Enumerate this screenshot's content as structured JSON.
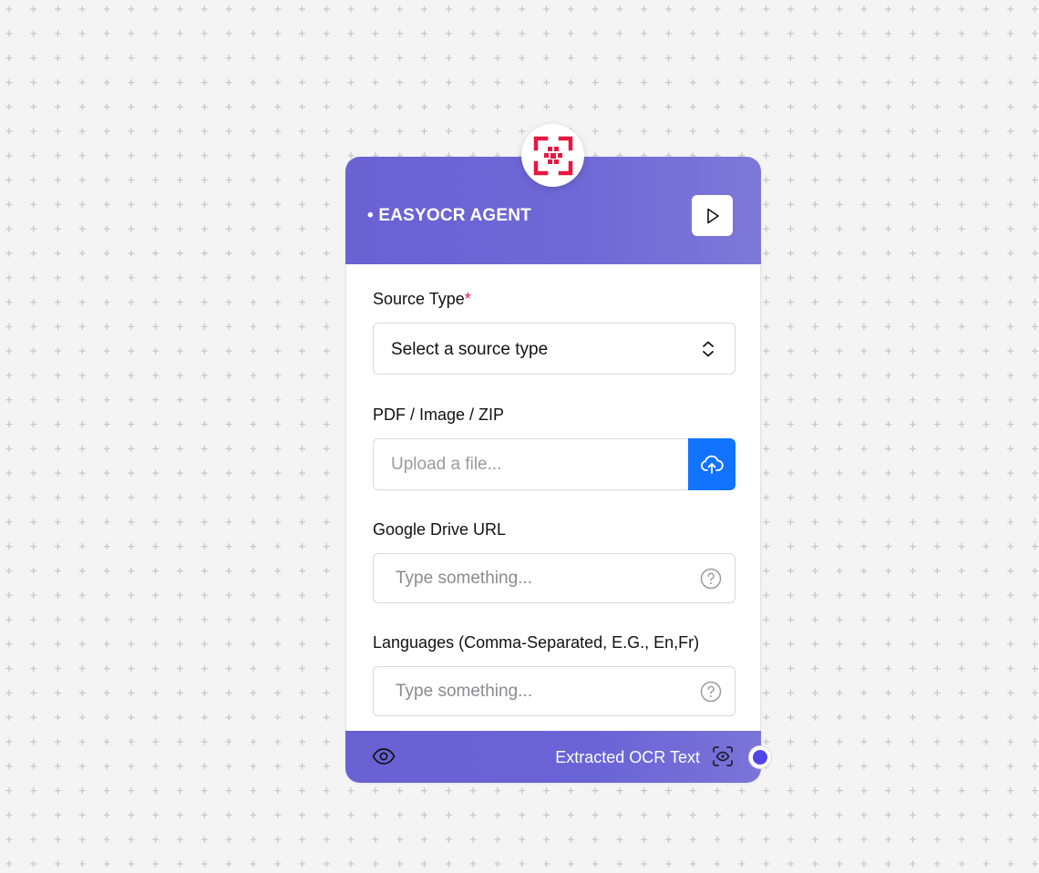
{
  "node": {
    "title": "• EASYOCR AGENT",
    "logo_icon": "ocr-scan-icon",
    "run_icon": "play-icon",
    "accent_color": "#6a61d3",
    "logo_color": "#e8173f"
  },
  "fields": {
    "source_type": {
      "label": "Source Type",
      "required_mark": "*",
      "selected_value": "Select a source type",
      "icon": "chevron-up-down-icon"
    },
    "file_upload": {
      "label": "PDF / Image / ZIP",
      "placeholder": "Upload a file...",
      "button_icon": "cloud-upload-icon",
      "button_color": "#1273ff"
    },
    "drive_url": {
      "label": "Google Drive URL",
      "placeholder": "Type something...",
      "help_icon": "question-circle-icon"
    },
    "languages": {
      "label": "Languages (Comma-Separated, E.G., En,Fr)",
      "placeholder": "Type something...",
      "help_icon": "question-circle-icon"
    }
  },
  "footer": {
    "preview_icon": "eye-icon",
    "output_label": "Extracted OCR Text",
    "output_icon": "scan-eye-icon",
    "handle_color": "#4f46e5"
  }
}
